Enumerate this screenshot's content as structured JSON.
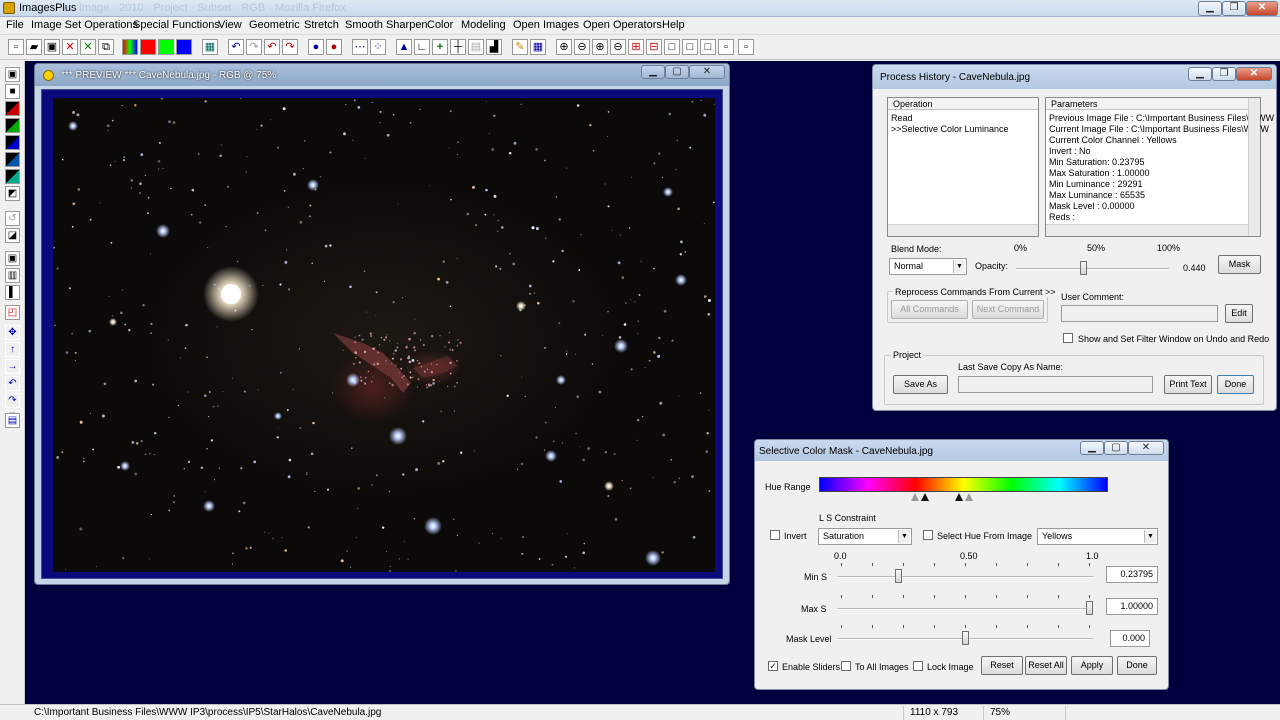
{
  "app": {
    "title": "ImagesPlus",
    "title_faded": "· Image · 2010 · Project · Subset · RGB · Mozilla Firefox"
  },
  "menu": [
    "File",
    "Image Set Operations",
    "Special Functions",
    "View",
    "Geometric",
    "Stretch",
    "Smooth Sharpen",
    "Color",
    "Modeling",
    "Open Images",
    "Open Operators",
    "Help"
  ],
  "preview": {
    "title": "*** PREVIEW *** CaveNebula.jpg - RGB @ 75%"
  },
  "process_history": {
    "title": "Process History - CaveNebula.jpg",
    "operation_header": "Operation",
    "operations": [
      "Read",
      ">>Selective Color Luminance"
    ],
    "parameters_header": "Parameters",
    "parameters": [
      "Previous Image File : C:\\Important Business Files\\WWW",
      "Current Image File : C:\\Important Business Files\\WWW",
      "Current Color Channel : Yellows",
      "Invert : No",
      "Min Saturation: 0.23795",
      "Max Saturation : 1.00000",
      "Min Luminance : 29291",
      "Max Luminance : 65535",
      "Mask Level : 0.00000",
      "Reds :"
    ],
    "blend_mode_label": "Blend Mode:",
    "blend_mode_value": "Normal",
    "opacity_label": "Opacity:",
    "opacity_ticks": [
      "0%",
      "50%",
      "100%"
    ],
    "opacity_value": "0.440",
    "opacity_fraction": 0.44,
    "mask_button": "Mask",
    "reprocess_label": "Reprocess Commands From Current >>",
    "all_commands_button": "All Commands",
    "next_command_button": "Next Command",
    "user_comment_label": "User Comment:",
    "user_comment_value": "",
    "edit_button": "Edit",
    "show_filter_label": "Show and Set Filter Window on Undo and Redo",
    "show_filter_checked": false,
    "project_label": "Project",
    "save_as_button": "Save As",
    "last_save_label": "Last Save Copy As Name:",
    "last_save_value": "",
    "print_text_button": "Print Text",
    "done_button": "Done"
  },
  "selective_color": {
    "title": "Selective Color Mask - CaveNebula.jpg",
    "hue_range_label": "Hue Range",
    "ls_constraint_label": "L S Constraint",
    "invert_label": "Invert",
    "invert_checked": false,
    "constraint_value": "Saturation",
    "select_hue_label": "Select Hue From Image",
    "select_hue_checked": false,
    "color_channel_value": "Yellows",
    "scale_ticks": [
      "0.0",
      "0.50",
      "1.0"
    ],
    "min_s_label": "Min S",
    "min_s_value": "0.23795",
    "min_s_fraction": 0.23795,
    "max_s_label": "Max S",
    "max_s_value": "1.00000",
    "max_s_fraction": 1.0,
    "mask_level_label": "Mask Level",
    "mask_level_value": "0.000",
    "mask_level_fraction": 0.5,
    "enable_sliders_label": "Enable Sliders",
    "enable_sliders_checked": true,
    "to_all_images_label": "To All Images",
    "to_all_images_checked": false,
    "lock_image_label": "Lock Image",
    "lock_image_checked": false,
    "reset_button": "Reset",
    "reset_all_button": "Reset All",
    "apply_button": "Apply",
    "done_button": "Done"
  },
  "status": {
    "path": "C:\\Important Business Files\\WWW IP3\\process\\IP5\\StarHalos\\CaveNebula.jpg",
    "dimensions": "1110 x 793",
    "zoom": "75%"
  },
  "colors": {
    "workspace": "#00003e",
    "preview_frame": "#0a0a7a"
  }
}
